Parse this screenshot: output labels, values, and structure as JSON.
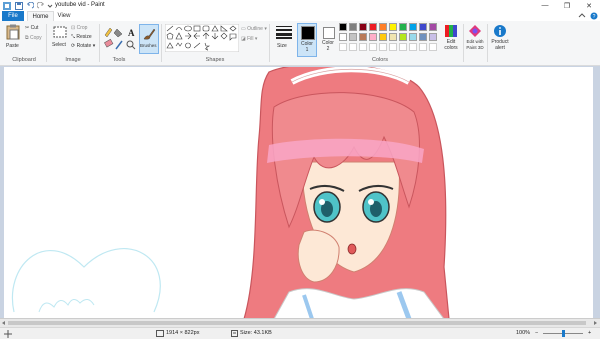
{
  "window": {
    "title": "youtube vid - Paint",
    "minimize_glyph": "—",
    "maximize_glyph": "❐",
    "close_glyph": "✕"
  },
  "tabs": [
    "File",
    "Home",
    "View"
  ],
  "ribbon": {
    "clipboard": {
      "paste": "Paste",
      "cut": "Cut",
      "copy": "Copy",
      "group": "Clipboard"
    },
    "image": {
      "select": "Select",
      "crop": "Crop",
      "resize": "Resize",
      "rotate": "Rotate",
      "group": "Image"
    },
    "tools": {
      "group": "Tools",
      "text_tool": "A"
    },
    "brushes": "Brushes",
    "shapes": {
      "outline": "Outline",
      "fill": "Fill",
      "group": "Shapes"
    },
    "size": "Size",
    "color1": {
      "label": "Color",
      "num": "1"
    },
    "color2": {
      "label": "Color",
      "num": "2"
    },
    "colors_group": "Colors",
    "edit_colors": {
      "line1": "Edit",
      "line2": "colors"
    },
    "edit_paint3d": {
      "line1": "Edit with",
      "line2": "Paint 3D"
    },
    "product_alert": {
      "line1": "Product",
      "line2": "alert"
    }
  },
  "palette_row1": [
    "#000000",
    "#7f7f7f",
    "#880015",
    "#ed1c24",
    "#ff7f27",
    "#fff200",
    "#22b14c",
    "#00a2e8",
    "#3f48cc",
    "#a349a4"
  ],
  "palette_row2": [
    "#ffffff",
    "#c3c3c3",
    "#b97a57",
    "#ffaec9",
    "#ffc90e",
    "#efe4b0",
    "#b5e61d",
    "#99d9ea",
    "#7092be",
    "#c8bfe7"
  ],
  "status": {
    "dimensions": "1914 × 822px",
    "size": "Size: 43.1KB",
    "zoom": "100%",
    "zoom_out": "−",
    "zoom_in": "+"
  },
  "accent": "#1979ca",
  "zoom_level": 1.0
}
